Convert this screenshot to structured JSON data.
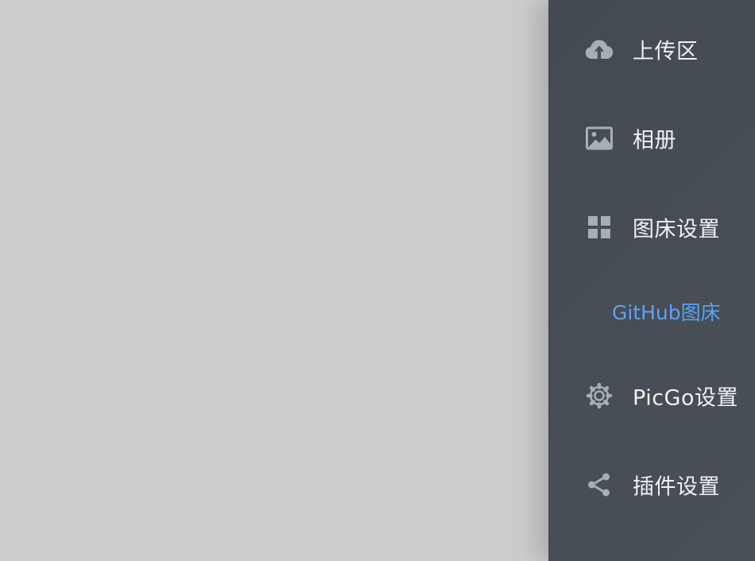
{
  "sidebar": {
    "items": [
      {
        "label": "上传区",
        "icon": "upload-cloud-icon"
      },
      {
        "label": "相册",
        "icon": "image-icon"
      },
      {
        "label": "图床设置",
        "icon": "grid-icon"
      },
      {
        "label": "PicGo设置",
        "icon": "gear-icon"
      },
      {
        "label": "插件设置",
        "icon": "share-icon"
      }
    ],
    "submenu": {
      "label": "GitHub图床",
      "active": true
    }
  },
  "colors": {
    "sidebar_bg": "#464c53",
    "backdrop": "#cccccc",
    "text": "#eef1f4",
    "icon": "#a7aeb7",
    "active": "#59a3f5"
  }
}
